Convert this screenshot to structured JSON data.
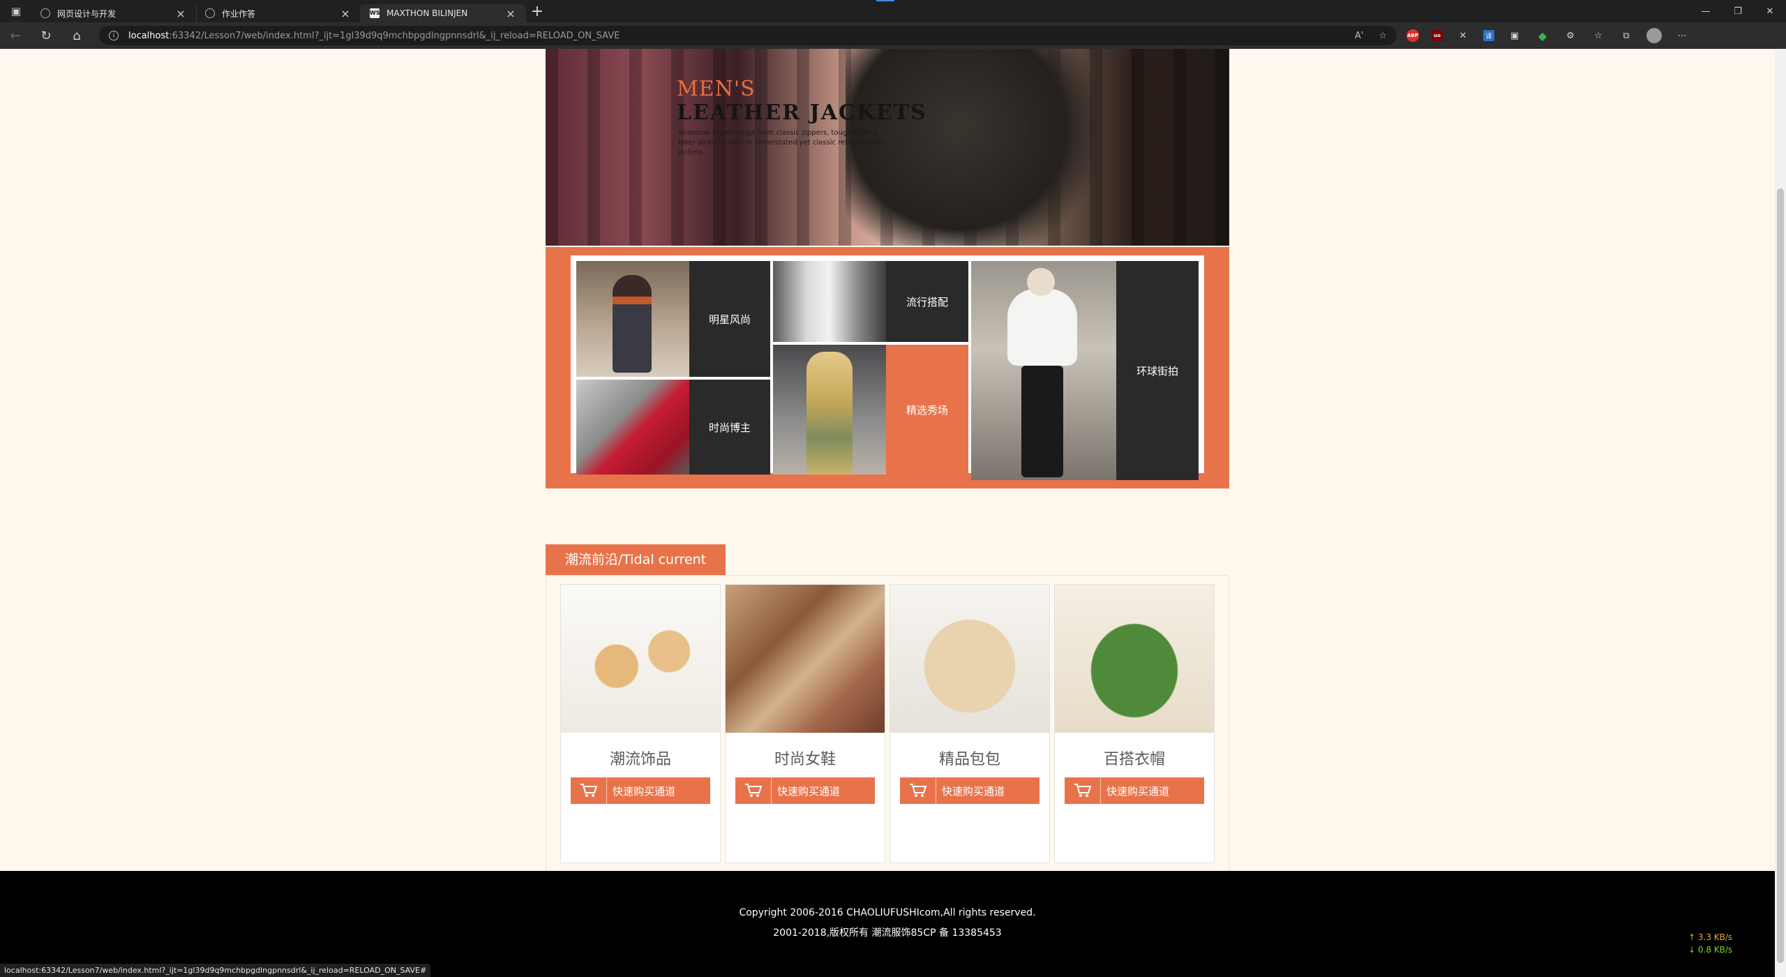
{
  "tabs": [
    {
      "label": "网页设计与开发",
      "active": false
    },
    {
      "label": "作业作答",
      "active": false
    },
    {
      "label": "MAXTHON BILINJEN",
      "active": true
    }
  ],
  "address": {
    "host": "localhost",
    "rest": ":63342/Lesson7/web/index.html?_ijt=1gl39d9q9mchbpgdlngpnnsdrl&_ij_reload=RELOAD_ON_SAVE"
  },
  "banner": {
    "line1": "MEN'S",
    "line2": "LEATHER JACKETS",
    "desc": "Seasonal Styles range from classic zippers, tough-talking biker jackets coats to understated yet classic retro bomber jackets"
  },
  "gallery": {
    "star": "明星风尚",
    "trend": "流行搭配",
    "blogger": "时尚博主",
    "show": "精选秀场",
    "street": "环球街拍"
  },
  "section": {
    "title": "潮流前沿/Tidal current"
  },
  "products": [
    {
      "name": "潮流饰品",
      "buy": "快速购买通道"
    },
    {
      "name": "时尚女鞋",
      "buy": "快速购买通道"
    },
    {
      "name": "精品包包",
      "buy": "快速购买通道"
    },
    {
      "name": "百搭衣帽",
      "buy": "快速购买通道"
    }
  ],
  "footer": {
    "copyright": "Copyright 2006-2016 CHAOLIUFUSHIcom,All rights reserved.",
    "icp": "2001-2018,版权所有 潮流服饰85CP 备 13385453"
  },
  "status_url": "localhost:63342/Lesson7/web/index.html?_ijt=1gl39d9q9mchbpgdlngpnnsdrl&_ij_reload=RELOAD_ON_SAVE#",
  "net": {
    "up": "↑ 3.3 KB/s",
    "down": "↓ 0.8 KB/s"
  },
  "colors": {
    "accent": "#e8734a",
    "dark_panel": "#2a2a2a",
    "page_bg": "#fff8ee",
    "footer": "#000000"
  }
}
